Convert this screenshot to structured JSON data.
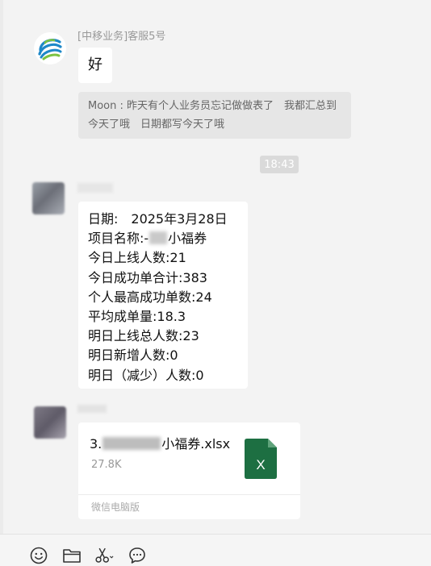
{
  "messages": {
    "service": {
      "sender": "[中移业务]客服5号",
      "text": "好",
      "quote": "Moon : 昨天有个人业务员忘记做做表了　我都汇总到今天了哦　日期都写今天了哦"
    },
    "time": "18:43",
    "report": {
      "lines": {
        "date": "日期:　2025年3月28日",
        "project_prefix": "项目名称:-",
        "project_suffix": "小福券",
        "online_today": "今日上线人数:21",
        "success_total": "今日成功单合计:383",
        "personal_max": "个人最高成功单数:24",
        "average": "平均成单量:18.3",
        "online_tomorrow": "明日上线总人数:23",
        "new_tomorrow": "明日新增人数:0",
        "decrease_tomorrow": "明日（减少）人数:0"
      }
    },
    "file": {
      "name_prefix": "3.",
      "name_suffix": "小福券.xlsx",
      "size": "27.8K",
      "source": "微信电脑版",
      "icon": "excel-file-icon",
      "icon_letter": "X",
      "icon_color": "#1d6f42"
    }
  },
  "toolbar": {
    "items": [
      "emoji-icon",
      "folder-icon",
      "scissors-icon",
      "chat-history-icon"
    ]
  },
  "colors": {
    "background": "#f3f3f3",
    "bubble": "#ffffff",
    "quote_bg": "#e6e6e6",
    "time_bg": "#dadada",
    "logo_blue": "#1e88c8",
    "logo_green": "#7cc242"
  }
}
